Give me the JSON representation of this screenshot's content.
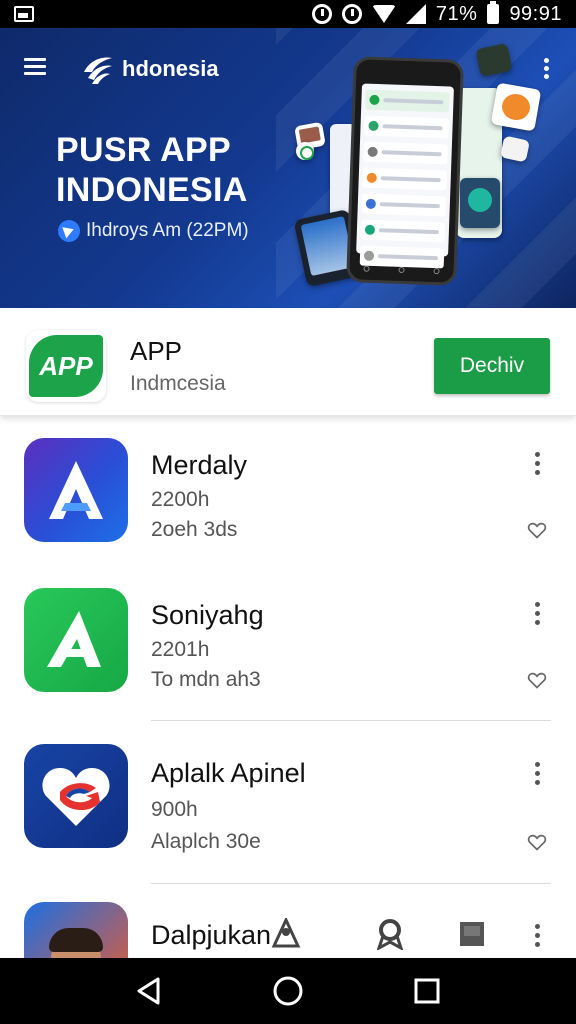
{
  "status_bar": {
    "battery_text": "71%",
    "time": "99:91"
  },
  "header": {
    "brand_name": "hdonesia",
    "hero_title_line1": "PUSR APP",
    "hero_title_line2": "INDONESIA",
    "hero_subtitle": "Ihdroys Am (22PM)"
  },
  "featured": {
    "logo_text": "APP",
    "title": "APP",
    "subtitle": "Indmcesia",
    "button_label": "Dechiv"
  },
  "apps": [
    {
      "name": "Merdaly",
      "meta1": "2200h",
      "meta2": "2oeh 3ds"
    },
    {
      "name": "Soniyahg",
      "meta1": "2201h",
      "meta2": "To mdn ah3"
    },
    {
      "name": "Aplalk Apinel",
      "meta1": "900h",
      "meta2": "Alaplch 30e"
    },
    {
      "name": "Dalpjukan",
      "meta1": "",
      "meta2": ""
    }
  ],
  "colors": {
    "hero_bg": "#13398f",
    "accent_green": "#1b9c46",
    "text_primary": "#111111",
    "text_secondary": "#555555"
  },
  "icons": {
    "status_left": "gallery-icon",
    "menu": "hamburger-menu-icon",
    "more": "more-vertical-icon",
    "favorite": "heart-outline-icon",
    "nav": [
      "back-icon",
      "home-icon",
      "recents-icon"
    ]
  }
}
